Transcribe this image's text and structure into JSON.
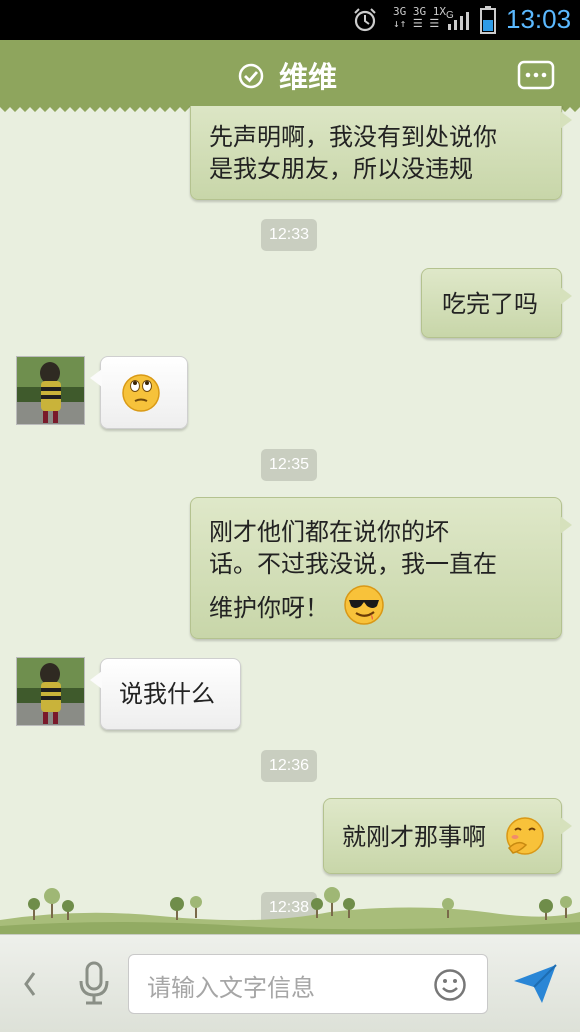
{
  "status_bar": {
    "net_top": "3G 3G 1X",
    "net_bottom": "↓↑ ☰ ☰",
    "g_label": "G",
    "time": "13:03",
    "icons": [
      "alarm-icon",
      "signal-icon",
      "battery-icon"
    ]
  },
  "header": {
    "title": "维维",
    "icons": [
      "verified-check-icon",
      "more-menu-icon"
    ]
  },
  "messages": [
    {
      "type": "out",
      "lines": [
        "先声明啊，我没有到处说你",
        "是我女朋友，所以没违规"
      ]
    },
    {
      "type": "time",
      "text": "12:33"
    },
    {
      "type": "out",
      "lines": [
        "吃完了吗"
      ]
    },
    {
      "type": "in",
      "emoji": "eyes-rolling-emoji"
    },
    {
      "type": "time",
      "text": "12:35"
    },
    {
      "type": "out",
      "lines": [
        "刚才他们都在说你的坏",
        "话。不过我没说，我一直在",
        "维护你呀！"
      ],
      "emoji": "sunglasses-emoji"
    },
    {
      "type": "in",
      "lines": [
        "说我什么"
      ]
    },
    {
      "type": "time",
      "text": "12:36"
    },
    {
      "type": "out",
      "lines": [
        "就刚才那事啊"
      ],
      "emoji": "shy-thinking-emoji"
    },
    {
      "type": "time",
      "text": "12:38"
    }
  ],
  "input_bar": {
    "placeholder": "请输入文字信息",
    "icons": [
      "back-arrow-icon",
      "microphone-icon",
      "smiley-icon",
      "send-plane-icon"
    ]
  },
  "colors": {
    "header_bg": "#8ea55d",
    "chat_bg": "#e9efdf",
    "out_bubble": "#d6e1bc",
    "in_bubble": "#ffffff",
    "clock": "#5bb9ff",
    "send": "#2a86d6"
  }
}
